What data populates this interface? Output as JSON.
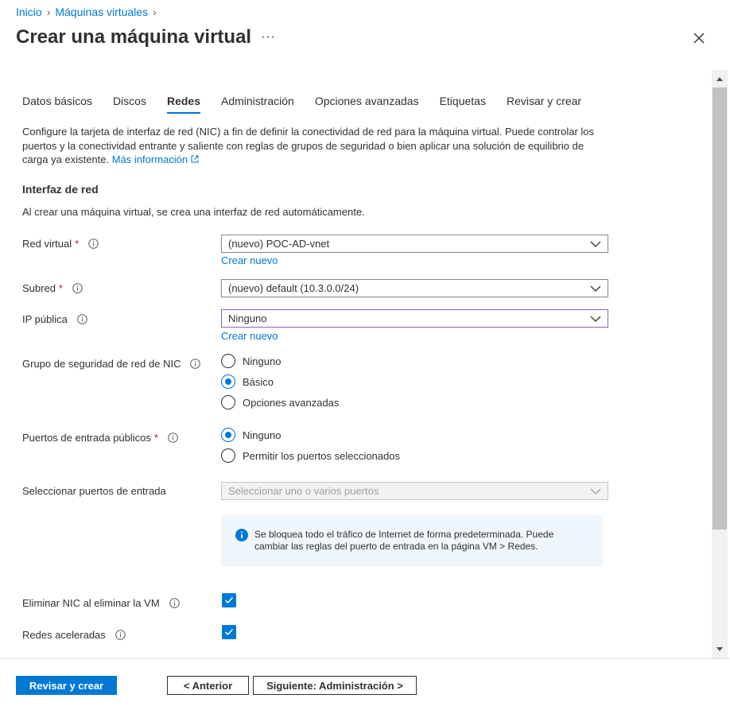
{
  "breadcrumb": {
    "items": [
      "Inicio",
      "Máquinas virtuales"
    ]
  },
  "title": "Crear una máquina virtual",
  "more_label": "···",
  "tabs": [
    {
      "label": "Datos básicos"
    },
    {
      "label": "Discos"
    },
    {
      "label": "Redes",
      "active": true
    },
    {
      "label": "Administración"
    },
    {
      "label": "Opciones avanzadas"
    },
    {
      "label": "Etiquetas"
    },
    {
      "label": "Revisar y crear"
    }
  ],
  "description": {
    "text": "Configure la tarjeta de interfaz de red (NIC) a fin de definir la conectividad de red para la máquina virtual. Puede controlar los puertos y la conectividad entrante y saliente con reglas de grupos de seguridad o bien aplicar una solución de equilibrio de carga ya existente.",
    "link": "Más información"
  },
  "network_interface": {
    "title": "Interfaz de red",
    "description": "Al crear una máquina virtual, se crea una interfaz de red automáticamente."
  },
  "fields": {
    "vnet": {
      "label": "Red virtual",
      "value": "(nuevo) POC-AD-vnet",
      "create_link": "Crear nuevo"
    },
    "subnet": {
      "label": "Subred",
      "value": "(nuevo) default (10.3.0.0/24)"
    },
    "public_ip": {
      "label": "IP pública",
      "value": "Ninguno",
      "create_link": "Crear nuevo"
    },
    "nsg": {
      "label": "Grupo de seguridad de red de NIC",
      "options": [
        "Ninguno",
        "Básico",
        "Opciones avanzadas"
      ],
      "selected": "Básico"
    },
    "inbound_ports": {
      "label": "Puertos de entrada públicos",
      "options": [
        "Ninguno",
        "Permitir los puertos seleccionados"
      ],
      "selected": "Ninguno"
    },
    "select_ports": {
      "label": "Seleccionar puertos de entrada",
      "placeholder": "Seleccionar uno o varios puertos"
    },
    "delete_nic": {
      "label": "Eliminar NIC al eliminar la VM",
      "checked": true
    },
    "accelerated": {
      "label": "Redes aceleradas",
      "checked": true
    }
  },
  "info_message": "Se bloquea todo el tráfico de Internet de forma predeterminada. Puede cambiar las reglas del puerto de entrada en la página VM > Redes.",
  "footer": {
    "review_create": "Revisar y crear",
    "previous": "< Anterior",
    "next": "Siguiente: Administración >"
  },
  "colors": {
    "accent": "#0078d4",
    "required": "#a4262c",
    "info_bg": "#eff6fc"
  }
}
